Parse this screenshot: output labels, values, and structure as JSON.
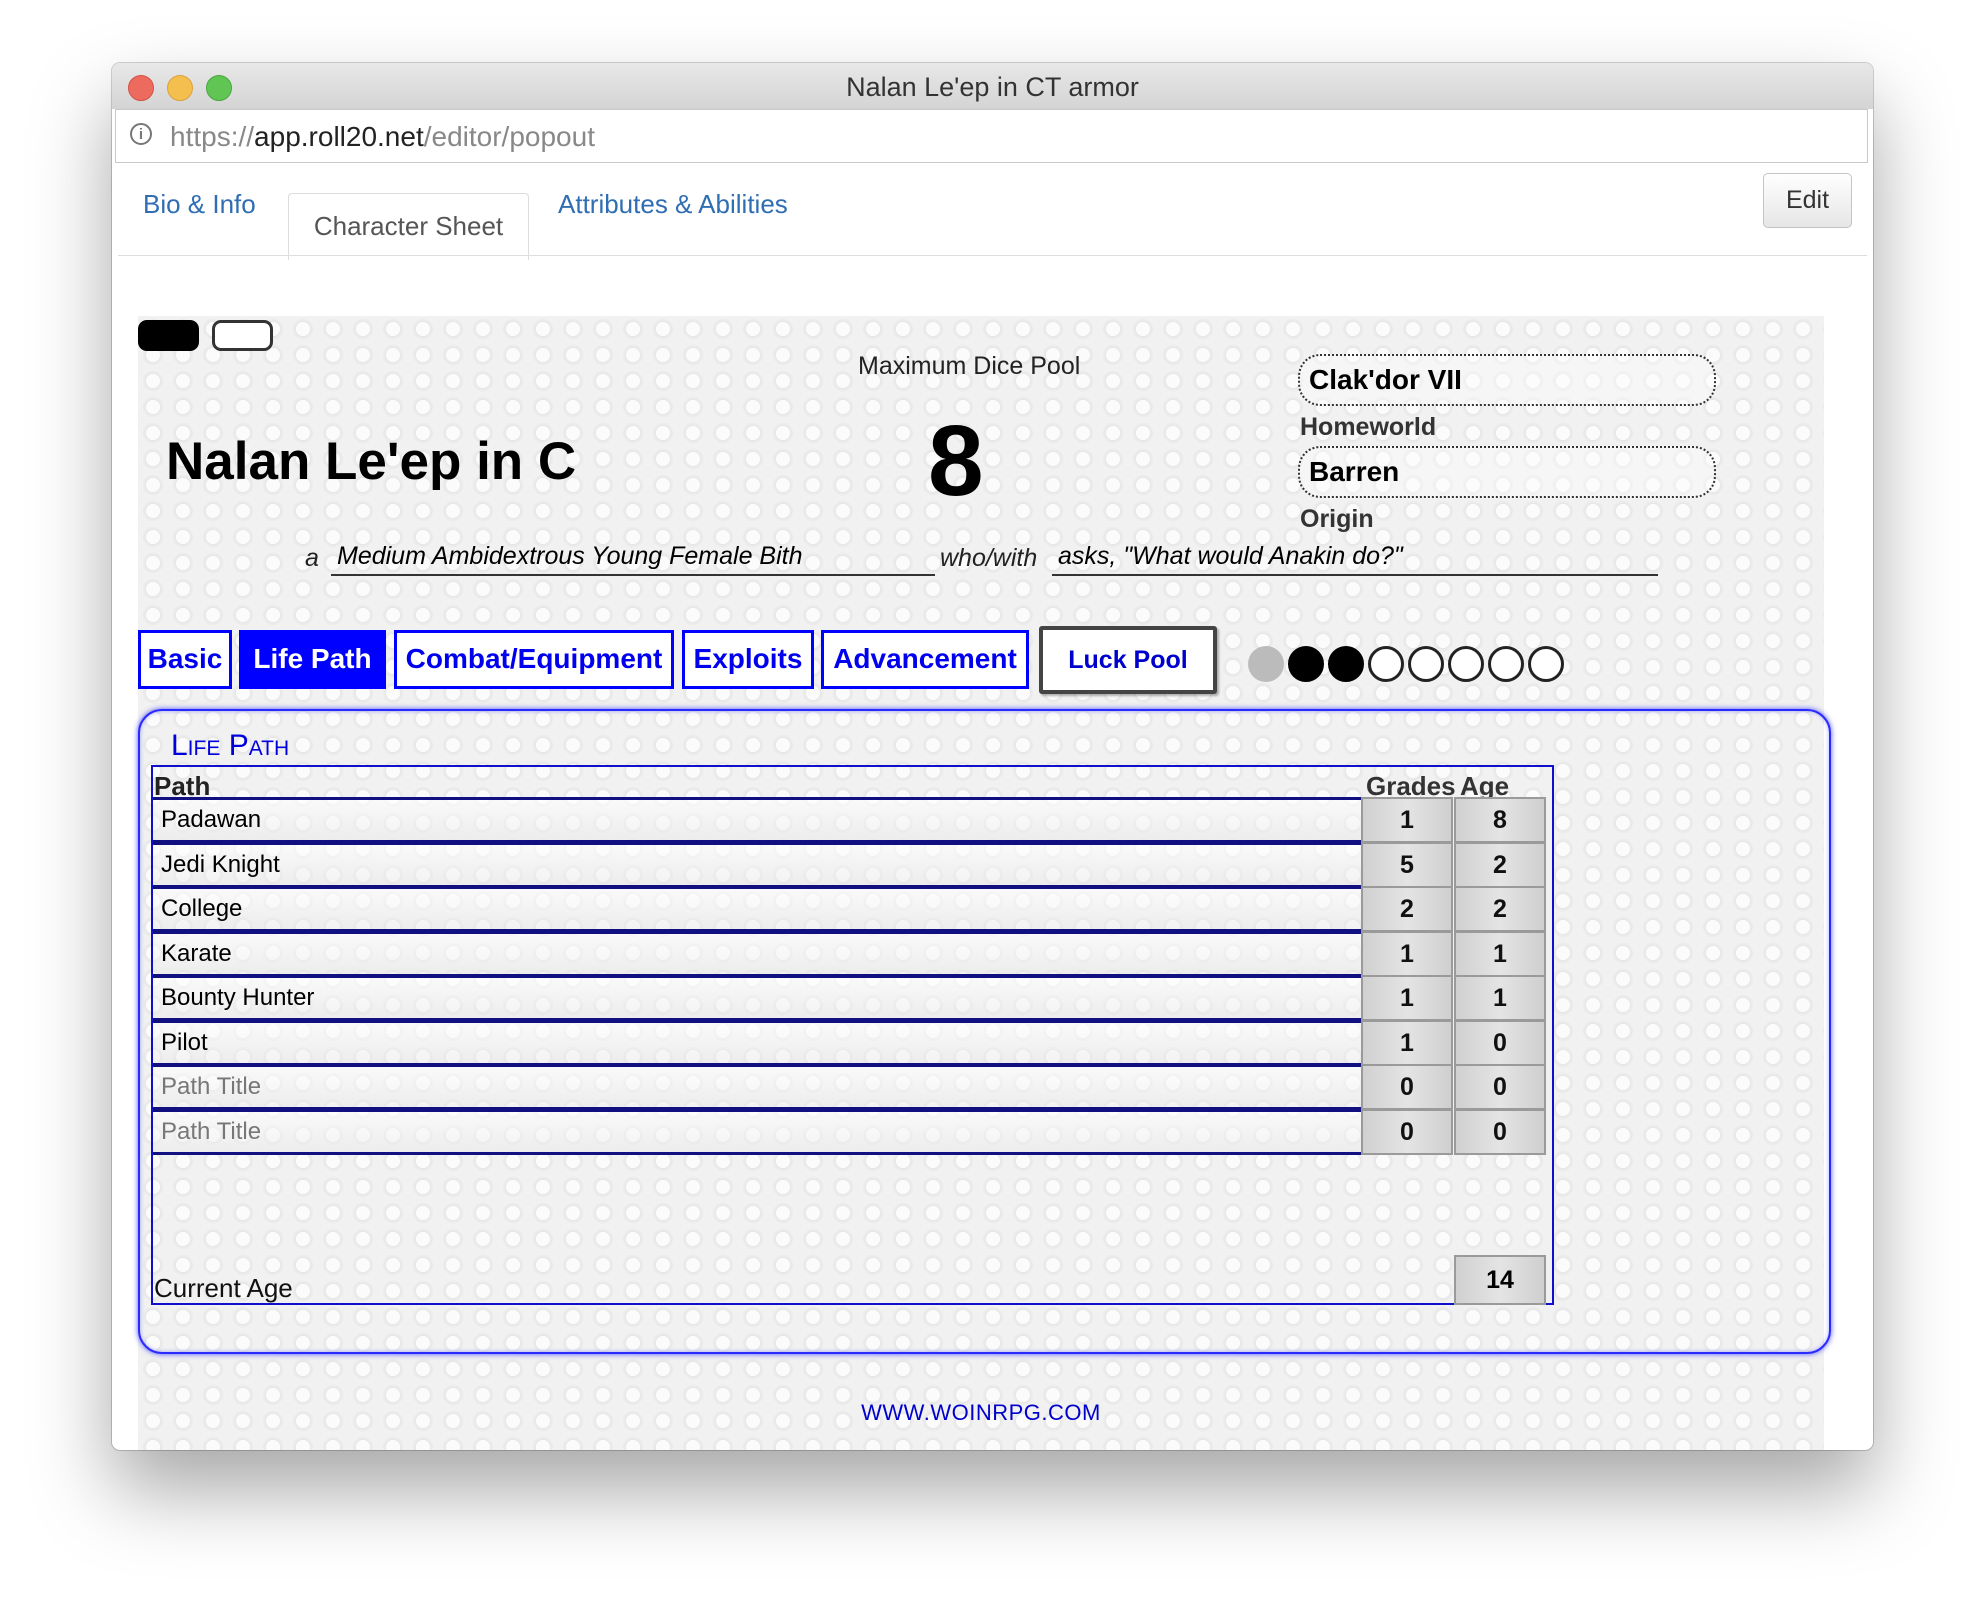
{
  "window": {
    "title": "Nalan Le'ep in CT armor",
    "url_scheme": "https://",
    "url_host": "app.roll20.net",
    "url_path": "/editor/popout"
  },
  "tabs": {
    "bio": "Bio & Info",
    "sheet": "Character Sheet",
    "attrs": "Attributes & Abilities",
    "edit": "Edit"
  },
  "header": {
    "name": "Nalan Le'ep in C",
    "dice_label": "Maximum Dice Pool",
    "dice_value": "8",
    "homeworld_value": "Clak'dor VII",
    "homeworld_label": "Homeworld",
    "origin_value": "Barren",
    "origin_label": "Origin",
    "article": "a",
    "description": "Medium Ambidextrous Young Female Bith",
    "who_with": "who/with",
    "quote": "asks, \"What would Anakin do?\""
  },
  "nav": {
    "basic": "Basic",
    "life_path": "Life Path",
    "combat": "Combat/Equipment",
    "exploits": "Exploits",
    "advancement": "Advancement",
    "luck_pool": "Luck Pool"
  },
  "luck": {
    "total": 8,
    "filled": 2,
    "spent": 1
  },
  "life_path": {
    "title": "Life Path",
    "col_path": "Path",
    "col_grades": "Grades",
    "col_age": "Age",
    "rows": [
      {
        "path": "Padawan",
        "grades": "1",
        "age": "8"
      },
      {
        "path": "Jedi Knight",
        "grades": "5",
        "age": "2"
      },
      {
        "path": "College",
        "grades": "2",
        "age": "2"
      },
      {
        "path": "Karate",
        "grades": "1",
        "age": "1"
      },
      {
        "path": "Bounty Hunter",
        "grades": "1",
        "age": "1"
      },
      {
        "path": "Pilot",
        "grades": "1",
        "age": "0"
      },
      {
        "path": "Path Title",
        "grades": "0",
        "age": "0",
        "placeholder": true
      },
      {
        "path": "Path Title",
        "grades": "0",
        "age": "0",
        "placeholder": true
      }
    ],
    "current_age_label": "Current Age",
    "current_age": "14"
  },
  "footer": {
    "link": "WWW.WOINRPG.COM"
  }
}
